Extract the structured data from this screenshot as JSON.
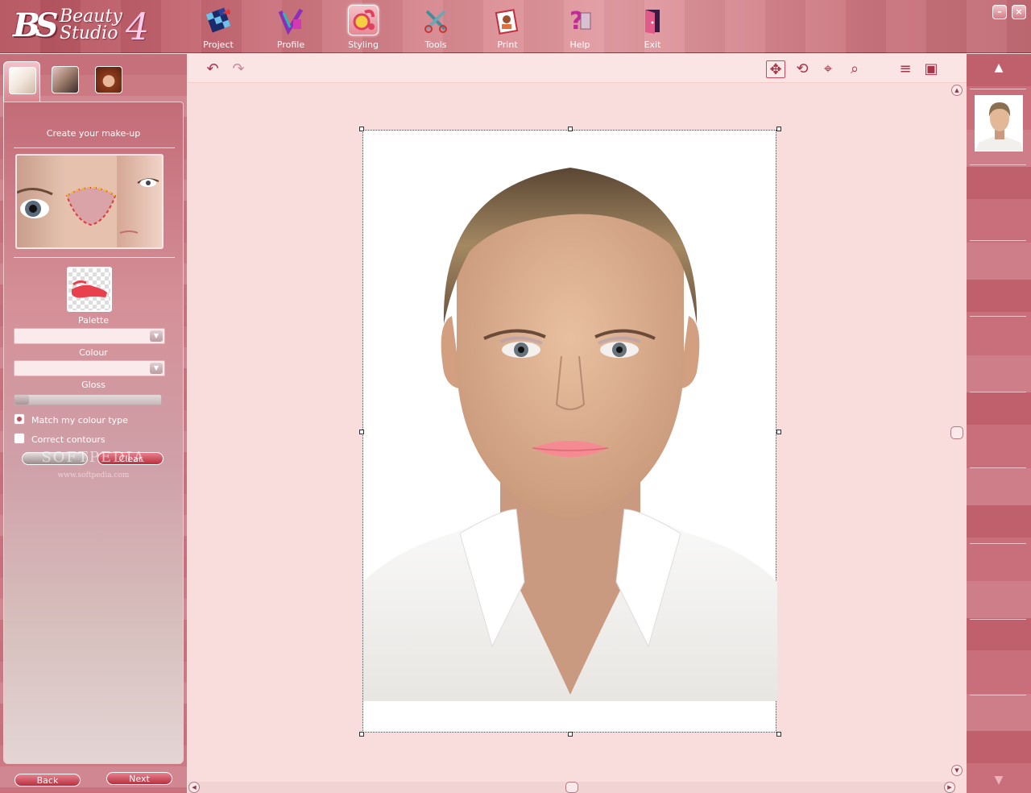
{
  "app": {
    "logo_name_line1": "Beauty",
    "logo_name_line2": "Studio",
    "logo_version": "4",
    "window_controls": {
      "minimize_icon": "minimize-icon",
      "close_icon": "close-icon"
    }
  },
  "nav": {
    "items": [
      {
        "label": "Project",
        "icon": "project-icon"
      },
      {
        "label": "Profile",
        "icon": "profile-icon"
      },
      {
        "label": "Styling",
        "icon": "styling-icon",
        "active": true
      },
      {
        "label": "Tools",
        "icon": "tools-icon"
      },
      {
        "label": "Print",
        "icon": "print-icon"
      },
      {
        "label": "Help",
        "icon": "help-icon"
      },
      {
        "label": "Exit",
        "icon": "exit-icon"
      }
    ]
  },
  "left_panel": {
    "tabs": [
      "makeup-tab",
      "glasses-tab",
      "hair-tab"
    ],
    "title": "Create your make-up",
    "palette_label": "Palette",
    "colour_label": "Colour",
    "gloss_label": "Gloss",
    "gloss_level": 0,
    "palette_value": "",
    "colour_value": "",
    "match_colour_type": {
      "label": "Match my colour type",
      "checked": true
    },
    "correct_contours": {
      "label": "Correct contours",
      "checked": false
    },
    "clear_button": "Clear",
    "back_button": "Back",
    "next_button": "Next",
    "watermark": "SOFTPEDIA",
    "watermark_url": "www.softpedia.com"
  },
  "toolbar": {
    "undo_icon": "undo-icon",
    "redo_icon": "redo-icon",
    "move_icon": "move-icon",
    "rotate_icon": "rotate-icon",
    "center_icon": "crosshair-icon",
    "zoom_icon": "zoom-icon",
    "list_icon": "menu-icon",
    "photo_icon": "photo-icon"
  },
  "colors": {
    "accent": "#c0606d",
    "canvas_bg": "#f9dcdc",
    "active_button": "#e48a95"
  }
}
